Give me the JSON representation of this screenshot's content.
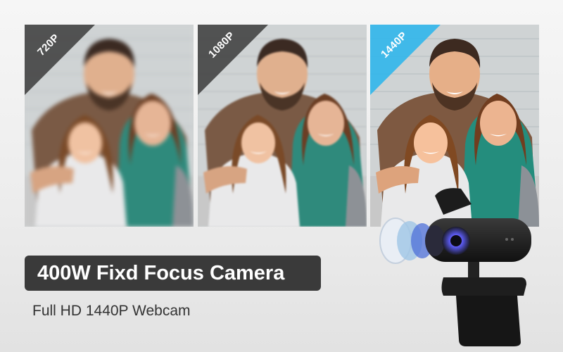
{
  "panels": [
    {
      "resolution": "720P",
      "badge_color": "#3b3b3b"
    },
    {
      "resolution": "1080P",
      "badge_color": "#3b3b3b"
    },
    {
      "resolution": "1440P",
      "badge_color": "#38b7ea"
    }
  ],
  "headline": "400W Fixd Focus Camera",
  "subheadline": "Full HD 1440P Webcam",
  "product": "webcam"
}
